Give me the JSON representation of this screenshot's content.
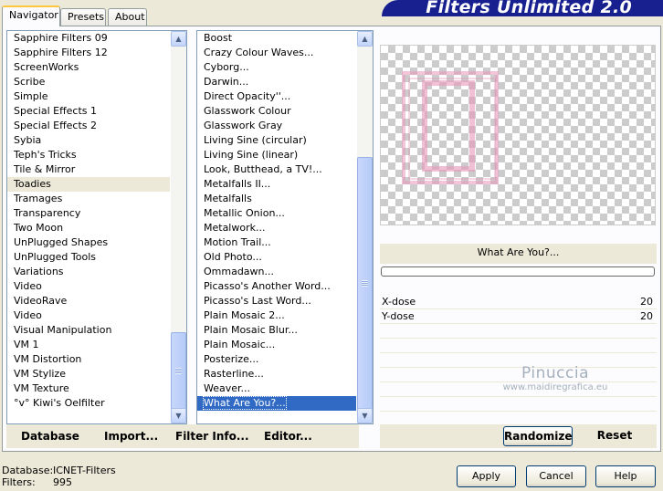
{
  "tabs": [
    "Navigator",
    "Presets",
    "About"
  ],
  "banner_title": "Filters Unlimited 2.0",
  "categories": [
    "Sapphire Filters 09",
    "Sapphire Filters 12",
    "ScreenWorks",
    "Scribe",
    "Simple",
    "Special Effects 1",
    "Special Effects 2",
    "Sybia",
    "Teph's Tricks",
    "Tile & Mirror",
    "Toadies",
    "Tramages",
    "Transparency",
    "Two Moon",
    "UnPlugged Shapes",
    "UnPlugged Tools",
    "Variations",
    "Video",
    "VideoRave",
    "Video",
    "Visual Manipulation",
    "VM 1",
    "VM Distortion",
    "VM Stylize",
    "VM Texture",
    "°v° Kiwi's Oelfilter"
  ],
  "selected_category": "Toadies",
  "filters": [
    "Boost",
    "Crazy Colour Waves...",
    "Cyborg...",
    "Darwin...",
    "Direct Opacity''...",
    "Glasswork Colour",
    "Glasswork Gray",
    "Living Sine (circular)",
    "Living Sine (linear)",
    "Look, Butthead, a TV!...",
    "Metalfalls II...",
    "Metalfalls",
    "Metallic Onion...",
    "Metalwork...",
    "Motion Trail...",
    "Old Photo...",
    "Ommadawn...",
    "Picasso's Another Word...",
    "Picasso's Last Word...",
    "Plain Mosaic 2...",
    "Plain Mosaic Blur...",
    "Plain Mosaic...",
    "Posterize...",
    "Rasterline...",
    "Weaver...",
    "What Are You?..."
  ],
  "selected_filter": "What Are You?...",
  "left_buttons": {
    "database": "Database",
    "import": "Import...",
    "filter_info": "Filter Info...",
    "editor": "Editor..."
  },
  "current_filter_label": "What Are You?...",
  "progress": 0,
  "params": [
    {
      "name": "X-dose",
      "value": "20"
    },
    {
      "name": "Y-dose",
      "value": "20"
    }
  ],
  "watermark": {
    "line1": "Pinuccia",
    "line2": "www.maidiregrafica.eu"
  },
  "right_buttons": {
    "randomize": "Randomize",
    "reset": "Reset"
  },
  "footer": {
    "database_label": "Database:",
    "database_value": "ICNET-Filters",
    "filters_label": "Filters:",
    "filters_value": "995"
  },
  "dialog_buttons": {
    "apply": "Apply",
    "cancel": "Cancel",
    "help": "Help"
  },
  "colors": {
    "banner": "#17208e",
    "selection": "#316ac5",
    "preview_frame": "#e7a6bf"
  },
  "icons": [
    "scroll-up-arrow-icon",
    "scroll-down-arrow-icon",
    "scroll-grip-icon"
  ]
}
